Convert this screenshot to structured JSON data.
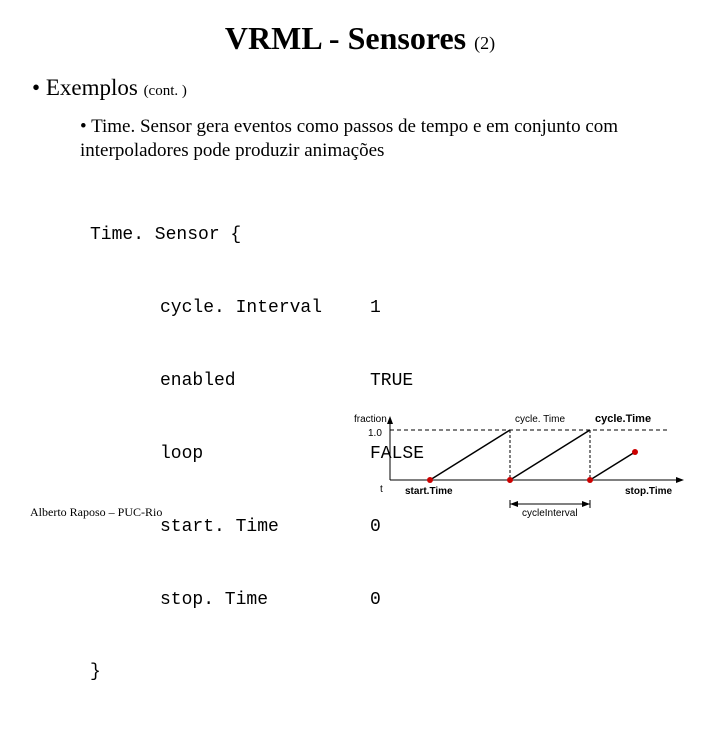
{
  "title": "VRML - Sensores",
  "title_suffix": "(2)",
  "bullet1": "Exemplos",
  "bullet1_cont": "(cont. )",
  "bullet2": "Time. Sensor gera eventos como passos de tempo e em conjunto com interpoladores pode produzir animações",
  "code": {
    "open": "Time. Sensor {",
    "fields": [
      {
        "key": "cycle. Interval",
        "val": "1"
      },
      {
        "key": "enabled",
        "val": "TRUE"
      },
      {
        "key": "loop",
        "val": "FALSE"
      },
      {
        "key": "start. Time",
        "val": "0"
      },
      {
        "key": "stop. Time",
        "val": "0"
      }
    ],
    "close": "}"
  },
  "footer": "Alberto Raposo – PUC-Rio",
  "diagram": {
    "ylabel": "fraction",
    "ymax": "1.0",
    "xlabel": "t",
    "start": "start.Time",
    "cycle": "cycle. Time",
    "cycle2": "cycle.Time",
    "interval": "cycleInterval",
    "stop": "stop.Time"
  }
}
